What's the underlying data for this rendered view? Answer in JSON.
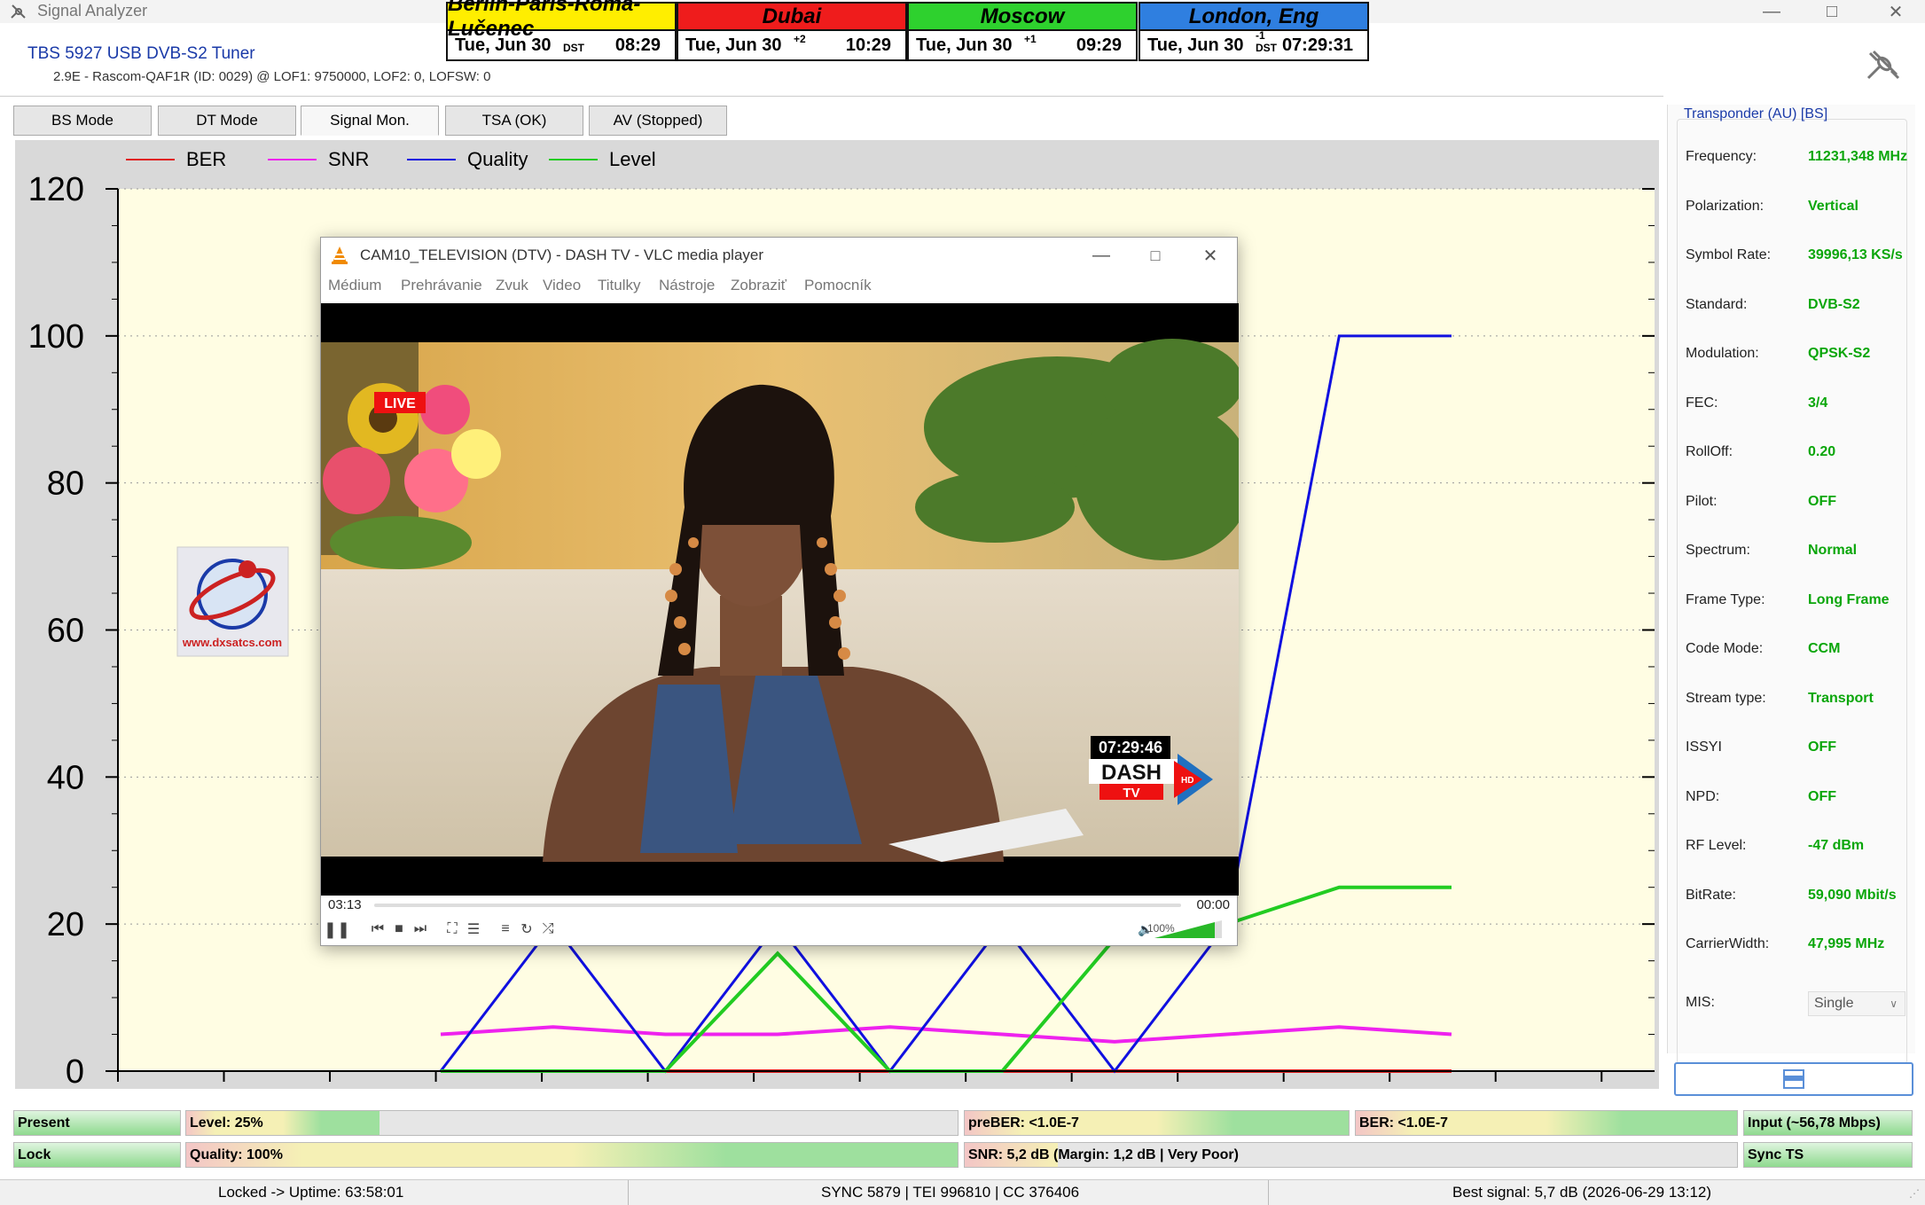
{
  "app": {
    "title": "Signal Analyzer"
  },
  "clocks": [
    {
      "city": "Berlin-Paris-Roma-Lučenec",
      "date": "Tue, Jun 30",
      "offset": "",
      "dst": "DST",
      "time": "08:29",
      "color": "#ffee00"
    },
    {
      "city": "Dubai",
      "date": "Tue, Jun 30",
      "offset": "+2",
      "dst": "",
      "time": "10:29",
      "color": "#ef1c1c"
    },
    {
      "city": "Moscow",
      "date": "Tue, Jun 30",
      "offset": "+1",
      "dst": "",
      "time": "09:29",
      "color": "#2ed12e"
    },
    {
      "city": "London, Eng",
      "date": "Tue, Jun 30",
      "offset": "-1",
      "dst": "DST",
      "time": "07:29:31",
      "color": "#2f7fe0"
    }
  ],
  "device": {
    "name": "TBS 5927 USB DVB-S2 Tuner",
    "info": "2.9E - Rascom-QAF1R (ID: 0029) @ LOF1: 9750000, LOF2: 0, LOFSW: 0"
  },
  "tabs": [
    {
      "label": "BS Mode",
      "active": false
    },
    {
      "label": "DT Mode",
      "active": false
    },
    {
      "label": "Signal Mon.",
      "active": true
    },
    {
      "label": "TSA (OK)",
      "active": false
    },
    {
      "label": "AV (Stopped)",
      "active": false
    }
  ],
  "chart_data": {
    "type": "line",
    "legend": [
      {
        "name": "BER",
        "color": "#e02020"
      },
      {
        "name": "SNR",
        "color": "#ee22ee"
      },
      {
        "name": "Quality",
        "color": "#1010e0"
      },
      {
        "name": "Level",
        "color": "#22cc22"
      }
    ],
    "yticks": [
      0,
      20,
      40,
      60,
      80,
      100,
      120
    ],
    "ylim": [
      0,
      120
    ],
    "grid": true,
    "legend_position": "top-left",
    "series": [
      {
        "name": "BER",
        "values": [
          0,
          0,
          0,
          0,
          0,
          0,
          0,
          0,
          0,
          0
        ]
      },
      {
        "name": "SNR",
        "values": [
          5,
          6,
          5,
          5,
          6,
          5,
          4,
          5,
          6,
          5
        ]
      },
      {
        "name": "Quality",
        "values": [
          0,
          20,
          0,
          20,
          0,
          20,
          0,
          20,
          100,
          100
        ]
      },
      {
        "name": "Level",
        "values": [
          0,
          0,
          0,
          16,
          0,
          0,
          18,
          20,
          25,
          25
        ]
      }
    ]
  },
  "watermark": {
    "text": "www.dxsatcs.com"
  },
  "vlc": {
    "title": "CAM10_TELEVISION (DTV) -  DASH TV - VLC media player",
    "menu": [
      "Médium",
      "Prehrávanie",
      "Zvuk",
      "Video",
      "Titulky",
      "Nástroje",
      "Zobraziť",
      "Pomocník"
    ],
    "time_elapsed": "03:13",
    "time_remaining": "00:00",
    "volume": "100%",
    "overlay_live": "LIVE",
    "overlay_clock": "07:29:46",
    "channel_logo": "DASH",
    "channel_logo_sub": "TV",
    "channel_logo_hd": "HD"
  },
  "transponder": {
    "title": "Transponder (AU) [BS]",
    "params": [
      {
        "label": "Frequency:",
        "value": "11231,348 MHz"
      },
      {
        "label": "Polarization:",
        "value": "Vertical"
      },
      {
        "label": "Symbol Rate:",
        "value": "39996,13 KS/s"
      },
      {
        "label": "Standard:",
        "value": "DVB-S2"
      },
      {
        "label": "Modulation:",
        "value": "QPSK-S2"
      },
      {
        "label": "FEC:",
        "value": "3/4"
      },
      {
        "label": "RollOff:",
        "value": "0.20"
      },
      {
        "label": "Pilot:",
        "value": "OFF"
      },
      {
        "label": "Spectrum:",
        "value": "Normal"
      },
      {
        "label": "Frame Type:",
        "value": "Long Frame"
      },
      {
        "label": "Code Mode:",
        "value": "CCM"
      },
      {
        "label": "Stream type:",
        "value": "Transport"
      },
      {
        "label": "ISSYI",
        "value": "OFF"
      },
      {
        "label": "NPD:",
        "value": "OFF"
      },
      {
        "label": "RF Level:",
        "value": "-47 dBm"
      },
      {
        "label": "BitRate:",
        "value": "59,090 Mbit/s"
      },
      {
        "label": "CarrierWidth:",
        "value": "47,995 MHz"
      }
    ],
    "mis_label": "MIS:",
    "mis_value": "Single"
  },
  "status": {
    "present": "Present",
    "level": "Level: 25%",
    "level_pct": 25,
    "preber": "preBER: <1.0E-7",
    "ber": "BER: <1.0E-7",
    "input": "Input (~56,78 Mbps)",
    "lock": "Lock",
    "quality": "Quality: 100%",
    "quality_pct": 100,
    "snr": "SNR: 5,2 dB (Margin: 1,2 dB | Very Poor)",
    "snr_pct": 12,
    "sync_ts": "Sync TS"
  },
  "footer": {
    "uptime": "Locked -> Uptime: 63:58:01",
    "counters": "SYNC 5879 | TEI 996810 | CC 376406",
    "best": "Best signal: 5,7 dB (2026-06-29 13:12)"
  }
}
